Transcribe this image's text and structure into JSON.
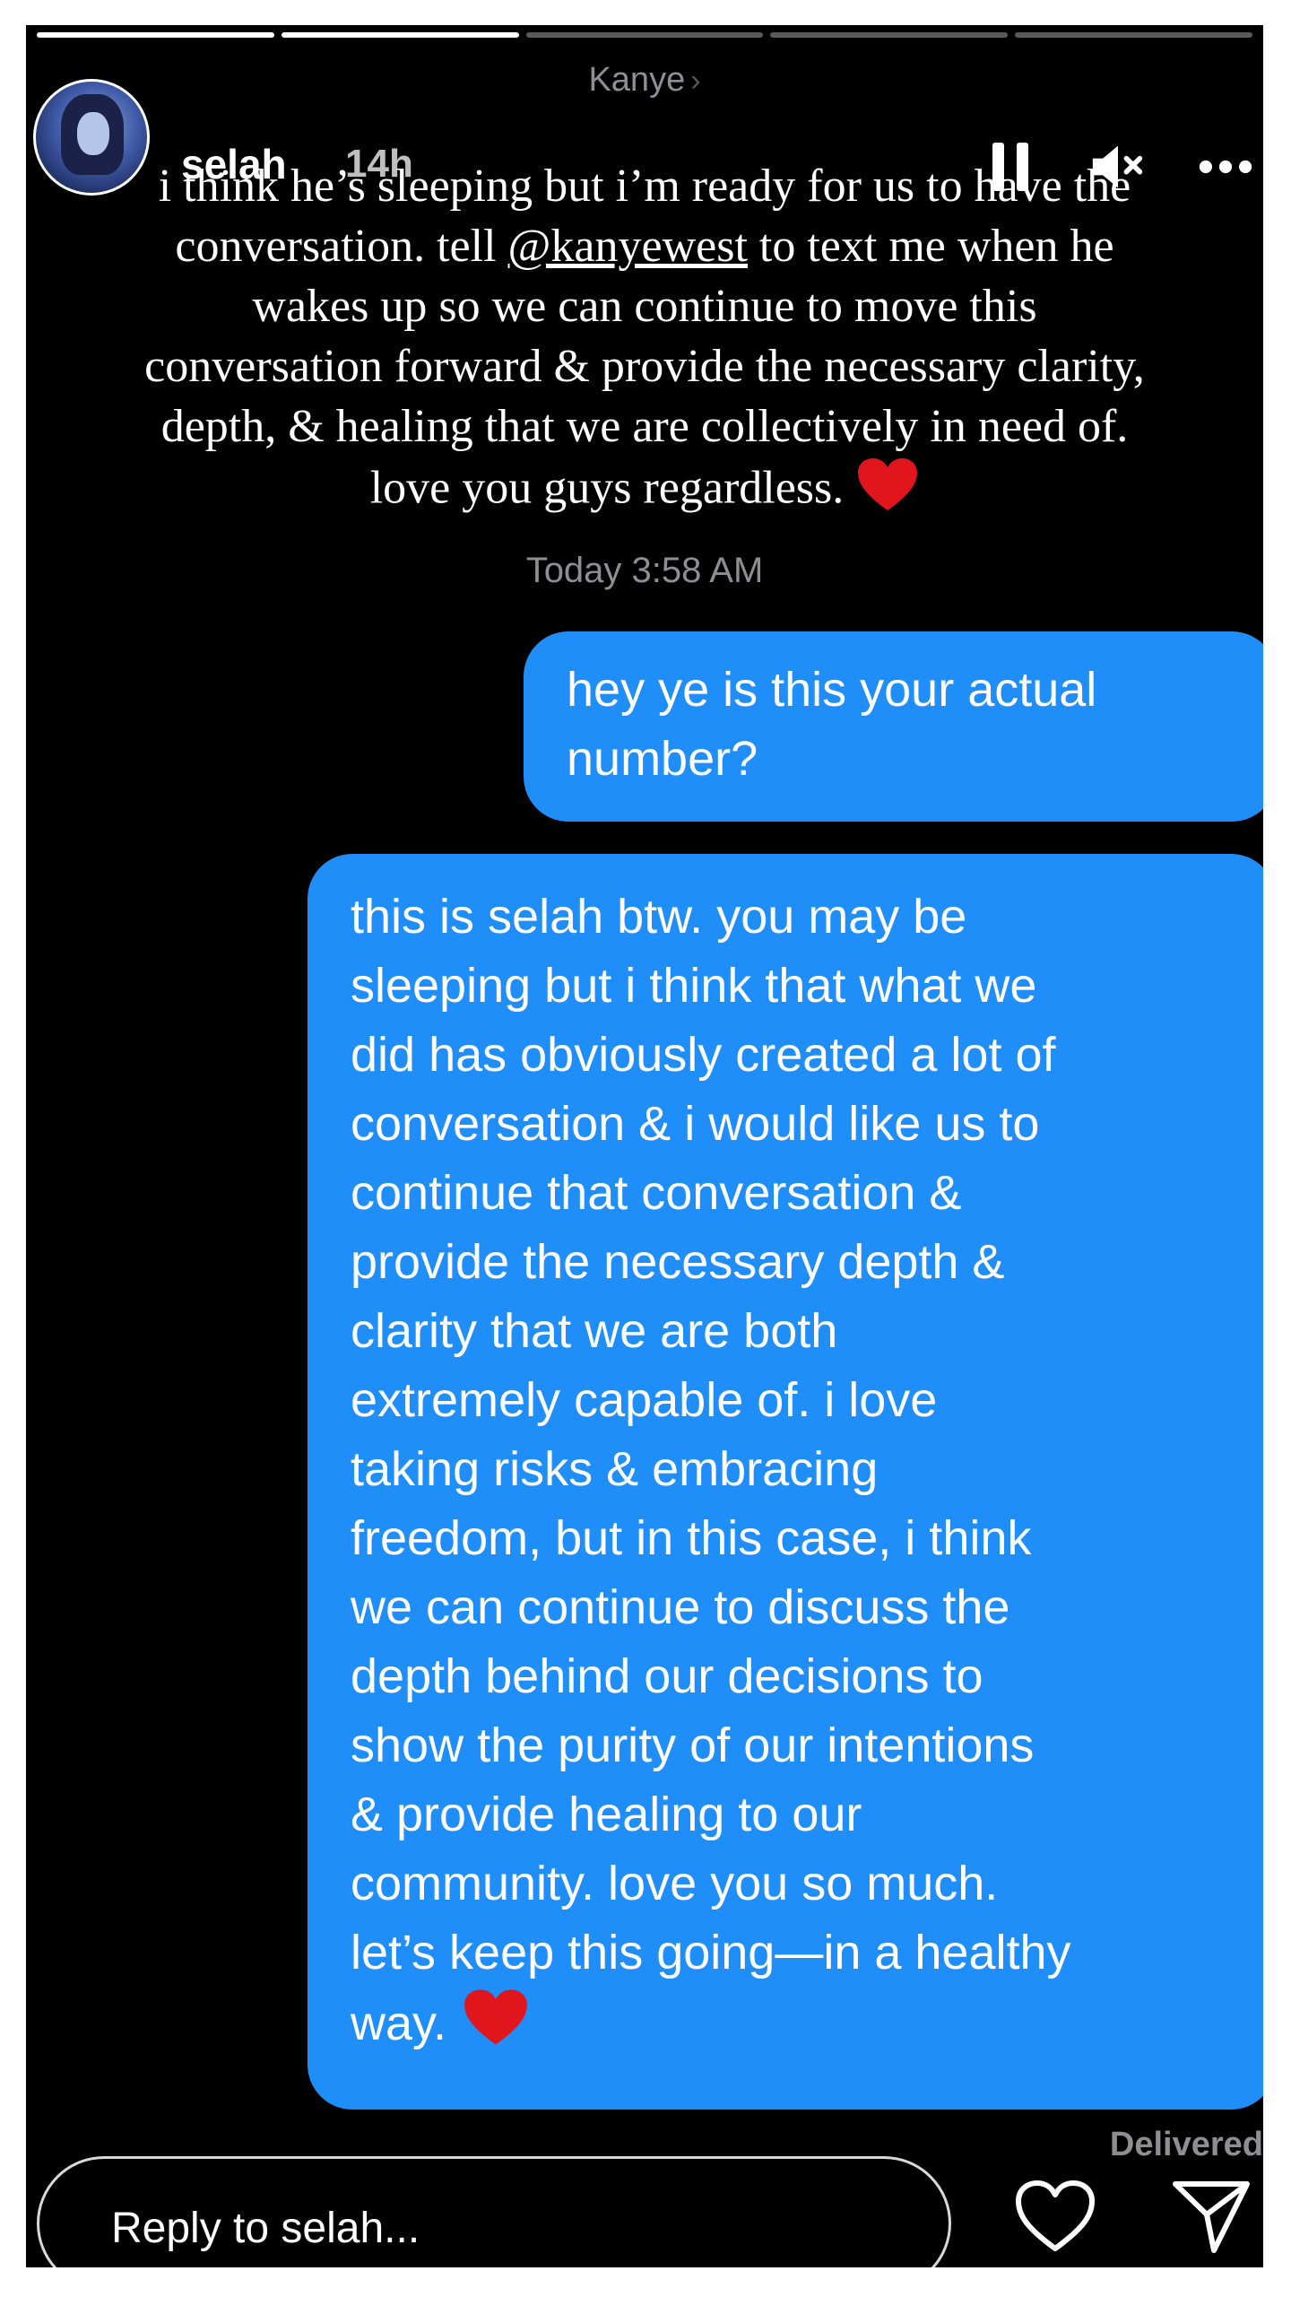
{
  "story": {
    "progress": [
      1,
      1,
      0,
      0,
      0
    ],
    "contact_name": "Kanye",
    "contact_chevron": "›",
    "user": {
      "username": "selah",
      "time_ago": "14h",
      "avatar_icon": "profile-photo"
    },
    "controls": {
      "pause_icon": "pause-icon",
      "mute_icon": "speaker-muted-icon",
      "more_icon": "more-horizontal-icon"
    },
    "caption": {
      "line1": "i think he’s sleeping but i’m ready for us to have the",
      "line2_pre": "conversation. tell ",
      "mention": "@kanyewest",
      "line2_post": " to text me when he",
      "line3": "wakes up so we can continue to move this",
      "line4": "conversation forward & provide the necessary clarity,",
      "line5": "depth, & healing that we are collectively in need of.",
      "line6": "love you guys regardless."
    }
  },
  "messages": {
    "timestamp": "Today 3:58 AM",
    "first_bubble": "hey ye is this your actual\nnumber?",
    "second_bubble": "this is selah btw. you may be\nsleeping but i think that what we\ndid has obviously created a lot of\nconversation & i would like us to\ncontinue that conversation &\nprovide the necessary depth &\nclarity that we are both\nextremely capable of. i love\ntaking risks & embracing\nfreedom, but in this case, i think\nwe can continue to discuss the\ndepth behind our decisions to\nshow the purity of our intentions\n& provide healing to our\ncommunity. love you so much.\nlet’s keep this going—in a healthy\nway.",
    "delivered": "Delivered",
    "bubble_color": "#1f8ef8"
  },
  "reply": {
    "placeholder": "Reply to selah...",
    "like_icon": "heart-outline-icon",
    "send_icon": "paper-plane-icon"
  },
  "colors": {
    "background": "#000000",
    "heart": "#e0161c"
  }
}
